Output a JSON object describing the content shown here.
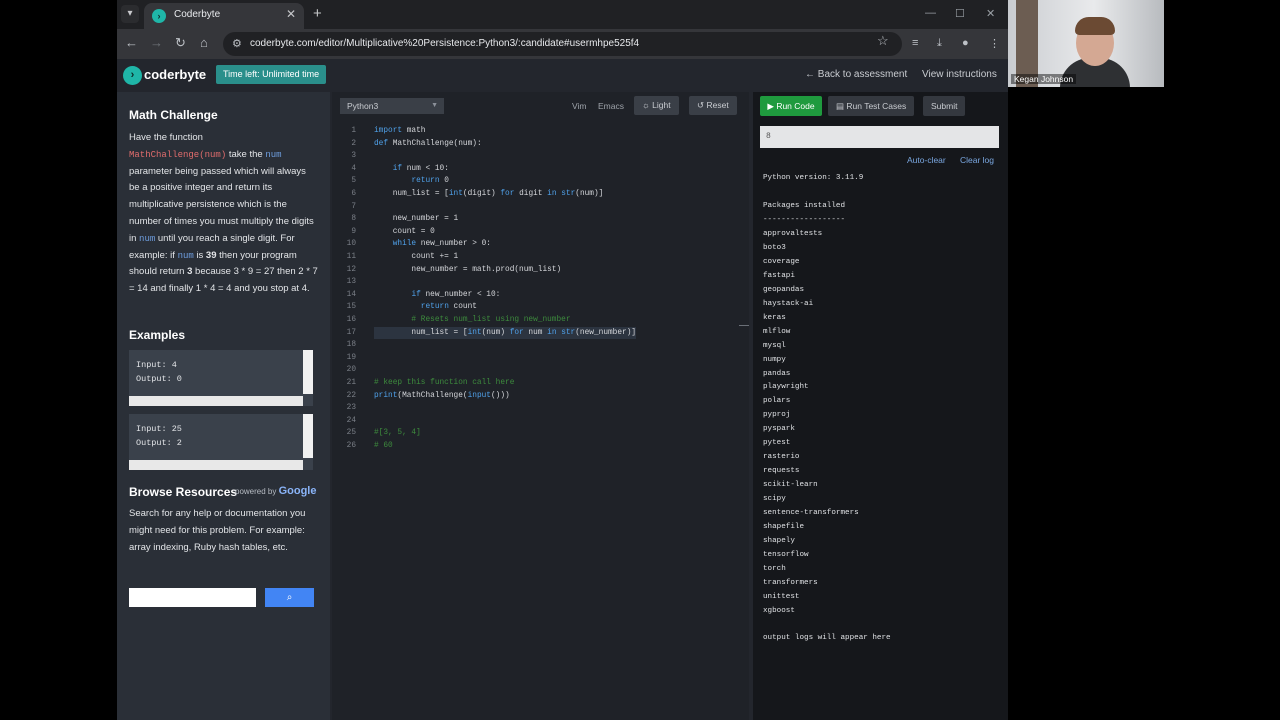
{
  "browser": {
    "tab_title": "Coderbyte",
    "url": "coderbyte.com/editor/Multiplicative%20Persistence:Python3/:candidate#usermhpe525f4"
  },
  "app": {
    "logo": "coderbyte",
    "time_badge": "Time left: Unlimited time",
    "back_link": "← Back to assessment",
    "view_instructions": "View instructions"
  },
  "challenge": {
    "title": "Math Challenge",
    "p1_a": "Have the function",
    "fn_name": "MathChallenge(num)",
    "p1_b": " take the ",
    "num_word": "num",
    "p1_c": " parameter being passed which will always be a positive integer and return its multiplicative persistence which is the number of times you must multiply the digits in ",
    "p1_d": " until you reach a single digit. For example: if ",
    "p1_e": " is ",
    "n39": "39",
    "p1_f": " then your program should return ",
    "n3": "3",
    "p1_g": " because 3 * 9 = 27 then 2 * 7 = 14 and finally 1 * 4 = 4 and you stop at 4.",
    "examples_title": "Examples",
    "examples": [
      {
        "input": "Input: 4",
        "output": "Output: 0"
      },
      {
        "input": "Input: 25",
        "output": "Output: 2"
      }
    ],
    "browse_title": "Browse Resources",
    "powered_by": "powered by",
    "powered_brand": "Google",
    "browse_text": "Search for any help or documentation you might need for this problem. For example: array indexing, Ruby hash tables, etc."
  },
  "editor": {
    "language": "Python3",
    "vim": "Vim",
    "emacs": "Emacs",
    "light": "Light",
    "reset": "Reset",
    "lines": [
      {
        "n": "1",
        "t": "import math"
      },
      {
        "n": "2",
        "t": "def MathChallenge(num):"
      },
      {
        "n": "3",
        "t": ""
      },
      {
        "n": "4",
        "t": "    if num < 10:"
      },
      {
        "n": "5",
        "t": "        return 0"
      },
      {
        "n": "6",
        "t": "    num_list = [int(digit) for digit in str(num)]"
      },
      {
        "n": "7",
        "t": ""
      },
      {
        "n": "8",
        "t": "    new_number = 1"
      },
      {
        "n": "9",
        "t": "    count = 0"
      },
      {
        "n": "10",
        "t": "    while new_number > 0:"
      },
      {
        "n": "11",
        "t": "        count += 1"
      },
      {
        "n": "12",
        "t": "        new_number = math.prod(num_list)"
      },
      {
        "n": "13",
        "t": ""
      },
      {
        "n": "14",
        "t": "        if new_number < 10:"
      },
      {
        "n": "15",
        "t": "          return count"
      },
      {
        "n": "16",
        "t": "        # Resets num_list using new_number"
      },
      {
        "n": "17",
        "t": "        num_list = [int(num) for num in str(new_number)]"
      },
      {
        "n": "18",
        "t": ""
      },
      {
        "n": "19",
        "t": ""
      },
      {
        "n": "20",
        "t": ""
      },
      {
        "n": "21",
        "t": "# keep this function call here"
      },
      {
        "n": "22",
        "t": "print(MathChallenge(input()))"
      },
      {
        "n": "23",
        "t": ""
      },
      {
        "n": "24",
        "t": ""
      },
      {
        "n": "25",
        "t": "#[3, 5, 4]"
      },
      {
        "n": "26",
        "t": "# 60"
      }
    ]
  },
  "console": {
    "run_code": "Run Code",
    "run_tests": "Run Test Cases",
    "submit": "Submit",
    "input_value": "8",
    "auto_clear": "Auto-clear",
    "clear_log": "Clear log",
    "python_version": "Python version: 3.11.9",
    "packages_title": "Packages installed",
    "separator": "------------------",
    "packages": [
      "approvaltests",
      "boto3",
      "coverage",
      "fastapi",
      "geopandas",
      "haystack-ai",
      "keras",
      "mlflow",
      "mysql",
      "numpy",
      "pandas",
      "playwright",
      "polars",
      "pyproj",
      "pyspark",
      "pytest",
      "rasterio",
      "requests",
      "scikit-learn",
      "scipy",
      "sentence-transformers",
      "shapefile",
      "shapely",
      "tensorflow",
      "torch",
      "transformers",
      "unittest",
      "xgboost"
    ],
    "footer": "output logs will appear here"
  },
  "webcam": {
    "name": "Kegan Johnson"
  },
  "colors": {
    "accent": "#2a8f8b",
    "run": "#1f9a3e",
    "keyword": "#4fa0e8",
    "comment": "#3d8b3d"
  }
}
